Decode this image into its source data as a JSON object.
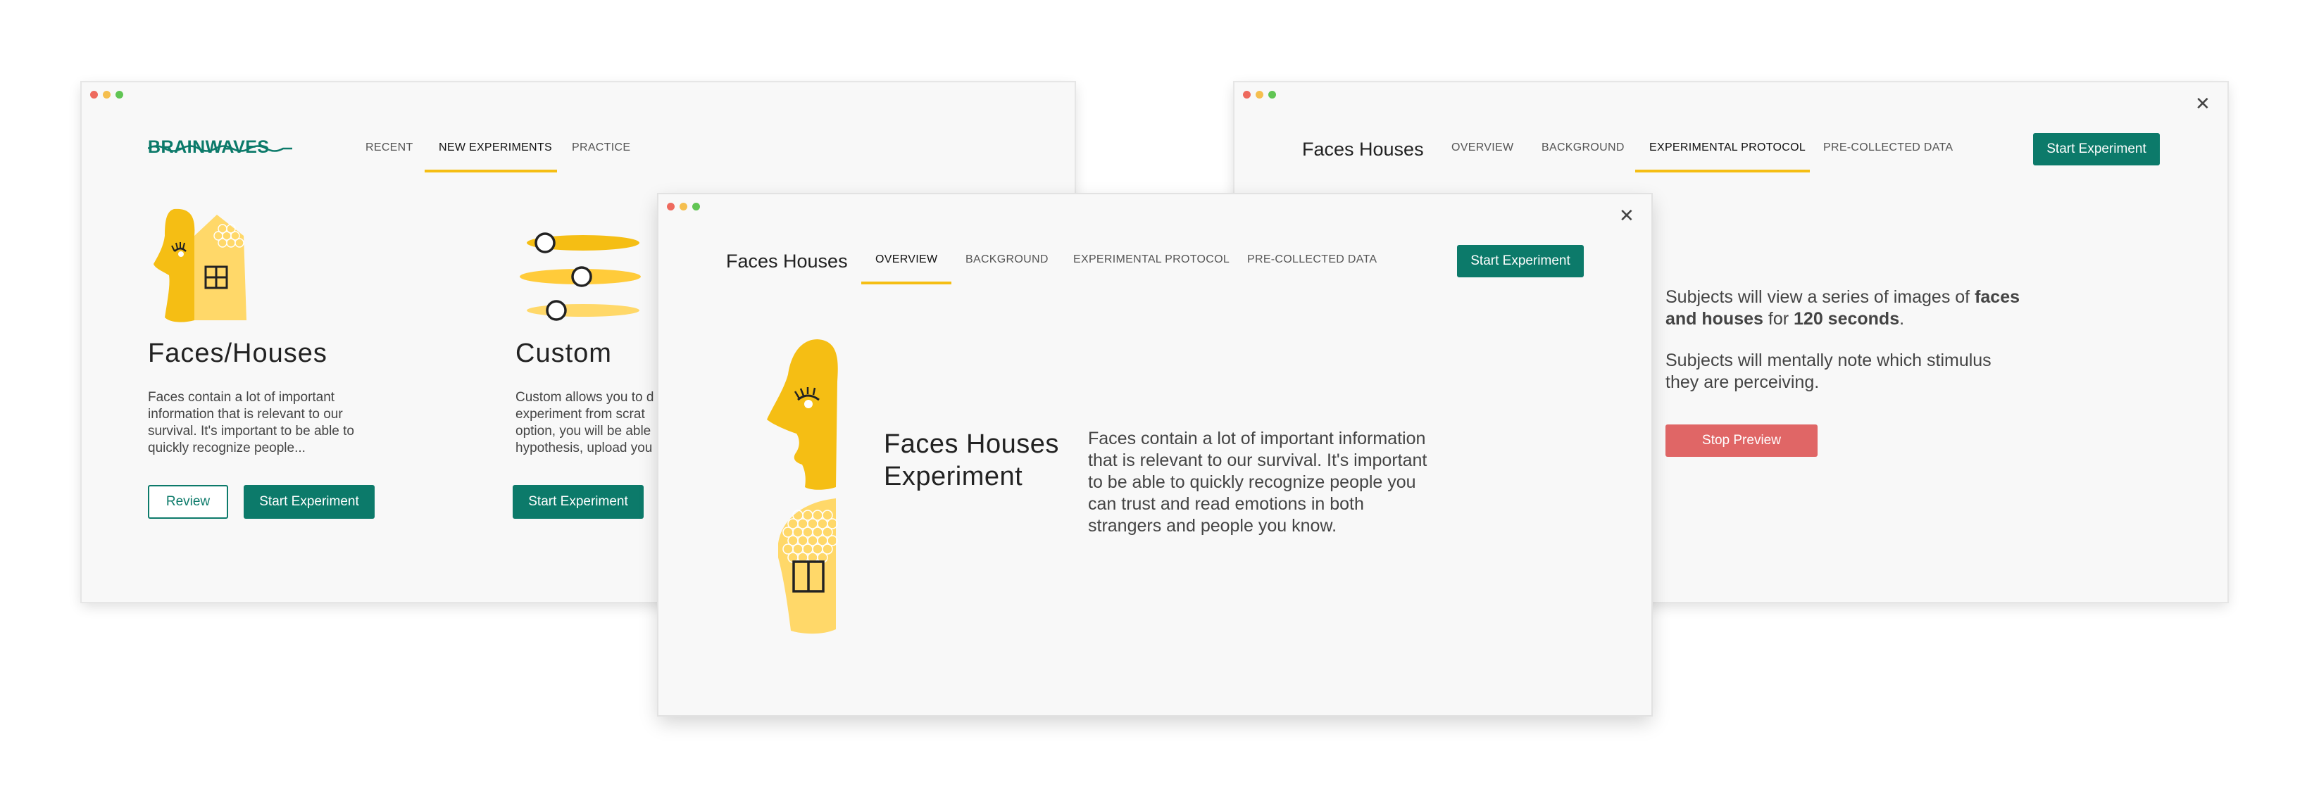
{
  "window1": {
    "logo_text": "BRAINWAVES",
    "tabs": [
      "RECENT",
      "NEW EXPERIMENTS",
      "PRACTICE"
    ],
    "active_tab": "NEW EXPERIMENTS",
    "cards": [
      {
        "title": "Faces/Houses",
        "description": "Faces contain a lot of important information that is relevant to our survival. It's important to be able to quickly recognize people...",
        "review_label": "Review",
        "start_label": "Start Experiment"
      },
      {
        "title": "Custom",
        "description": "Custom allows you to d experiment from scrat option, you will be able hypothesis, upload you",
        "start_label": "Start Experiment"
      }
    ]
  },
  "window2": {
    "title": "Faces Houses",
    "tabs": [
      "OVERVIEW",
      "BACKGROUND",
      "EXPERIMENTAL PROTOCOL",
      "PRE-COLLECTED DATA"
    ],
    "active_tab": "EXPERIMENTAL PROTOCOL",
    "start_label": "Start Experiment",
    "protocol_1_prefix": "Subjects will view a series of images of",
    "protocol_1_bold_a": "faces and houses",
    "protocol_1_mid": "for",
    "protocol_1_bold_b": "120 seconds",
    "protocol_1_end": ".",
    "protocol_2": "Subjects will mentally note which stimulus they are perceiving.",
    "stop_label": "Stop Preview"
  },
  "window3": {
    "title": "Faces Houses",
    "tabs": [
      "OVERVIEW",
      "BACKGROUND",
      "EXPERIMENTAL PROTOCOL",
      "PRE-COLLECTED DATA"
    ],
    "active_tab": "OVERVIEW",
    "start_label": "Start Experiment",
    "heading_line1": "Faces Houses",
    "heading_line2": "Experiment",
    "description": "Faces contain a lot of important information that is relevant to our survival. It's important to be able to quickly recognize people you can trust and read emotions in both strangers and people you know."
  },
  "colors": {
    "brand_green": "#0c7a6a",
    "accent_yellow": "#f5be14",
    "stop_red": "#e06666"
  }
}
